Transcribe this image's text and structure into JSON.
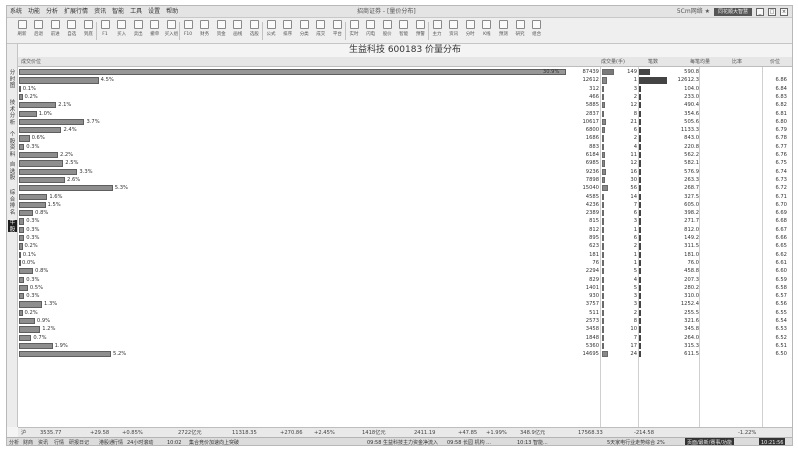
{
  "window": {
    "menu": [
      "系统",
      "功能",
      "分析",
      "扩展行情",
      "资讯",
      "智能",
      "工具",
      "设置",
      "帮助"
    ],
    "title": "招商证券 - [量价分布]",
    "right_text": "5Cm网络  ★",
    "login": "同花顺大智慧",
    "controls": [
      "_",
      "□",
      "×"
    ]
  },
  "toolbar": {
    "items": [
      "刷新",
      "后退",
      "前进",
      "自选",
      "到底",
      "F1",
      "买入",
      "卖出",
      "撤单",
      "买入组",
      "F10",
      "财务",
      "资金",
      "画线",
      "选股",
      "公式",
      "排序",
      "分类",
      "成交",
      "平台",
      "实时",
      "闪电",
      "股价",
      "智能",
      "预警",
      "主力",
      "资讯",
      "分时",
      "K线",
      "预测",
      "研究",
      "组合"
    ]
  },
  "sidebar": {
    "tabs": [
      "分时图",
      "技术分析",
      "个股资料",
      "自选股",
      "综合排名",
      "牛股"
    ]
  },
  "content": {
    "title": "生益科技 600183 价量分布",
    "columns": {
      "price": "成交价位",
      "volume": "成交量(手)",
      "count": "笔数",
      "avg": "每笔均量",
      "col5": "比率",
      "ratio": "价位"
    },
    "rows": [
      {
        "pct": "30.9%",
        "vol": "87439",
        "cnt": "149",
        "avg": "590.8",
        "ratio": "",
        "bar_pct": 30.9,
        "cnt_frac": 0.38,
        "hi": true
      },
      {
        "pct": "4.5%",
        "vol": "12612",
        "cnt": "1",
        "avg": "12612.3",
        "ratio": "6.86",
        "bar_pct": 4.5,
        "cnt_frac": 1.0
      },
      {
        "pct": "0.1%",
        "vol": "312",
        "cnt": "3",
        "avg": "104.0",
        "ratio": "6.84",
        "bar_pct": 0.1
      },
      {
        "pct": "0.2%",
        "vol": "466",
        "cnt": "2",
        "avg": "233.0",
        "ratio": "6.83",
        "bar_pct": 0.2
      },
      {
        "pct": "2.1%",
        "vol": "5885",
        "cnt": "12",
        "avg": "490.4",
        "ratio": "6.82",
        "bar_pct": 2.1
      },
      {
        "pct": "1.0%",
        "vol": "2837",
        "cnt": "8",
        "avg": "354.6",
        "ratio": "6.81",
        "bar_pct": 1.0
      },
      {
        "pct": "3.7%",
        "vol": "10617",
        "cnt": "21",
        "avg": "505.6",
        "ratio": "6.80",
        "bar_pct": 3.7
      },
      {
        "pct": "2.4%",
        "vol": "6800",
        "cnt": "6",
        "avg": "1133.3",
        "ratio": "6.79",
        "bar_pct": 2.4
      },
      {
        "pct": "0.6%",
        "vol": "1686",
        "cnt": "2",
        "avg": "843.0",
        "ratio": "6.78",
        "bar_pct": 0.6
      },
      {
        "pct": "0.3%",
        "vol": "883",
        "cnt": "4",
        "avg": "220.8",
        "ratio": "6.77",
        "bar_pct": 0.3
      },
      {
        "pct": "2.2%",
        "vol": "6184",
        "cnt": "11",
        "avg": "562.2",
        "ratio": "6.76",
        "bar_pct": 2.2
      },
      {
        "pct": "2.5%",
        "vol": "6985",
        "cnt": "12",
        "avg": "582.1",
        "ratio": "6.75",
        "bar_pct": 2.5
      },
      {
        "pct": "3.3%",
        "vol": "9236",
        "cnt": "16",
        "avg": "576.9",
        "ratio": "6.74",
        "bar_pct": 3.3
      },
      {
        "pct": "2.6%",
        "vol": "7898",
        "cnt": "30",
        "avg": "263.3",
        "ratio": "6.73",
        "bar_pct": 2.6
      },
      {
        "pct": "5.3%",
        "vol": "15040",
        "cnt": "56",
        "avg": "268.7",
        "ratio": "6.72",
        "bar_pct": 5.3
      },
      {
        "pct": "1.6%",
        "vol": "4585",
        "cnt": "14",
        "avg": "327.5",
        "ratio": "6.71",
        "bar_pct": 1.6
      },
      {
        "pct": "1.5%",
        "vol": "4236",
        "cnt": "7",
        "avg": "605.0",
        "ratio": "6.70",
        "bar_pct": 1.5
      },
      {
        "pct": "0.8%",
        "vol": "2389",
        "cnt": "6",
        "avg": "398.2",
        "ratio": "6.69",
        "bar_pct": 0.8
      },
      {
        "pct": "0.3%",
        "vol": "815",
        "cnt": "3",
        "avg": "271.7",
        "ratio": "6.68",
        "bar_pct": 0.3
      },
      {
        "pct": "0.3%",
        "vol": "812",
        "cnt": "1",
        "avg": "812.0",
        "ratio": "6.67",
        "bar_pct": 0.3
      },
      {
        "pct": "0.3%",
        "vol": "895",
        "cnt": "6",
        "avg": "149.2",
        "ratio": "6.66",
        "bar_pct": 0.3
      },
      {
        "pct": "0.2%",
        "vol": "623",
        "cnt": "2",
        "avg": "311.5",
        "ratio": "6.65",
        "bar_pct": 0.2
      },
      {
        "pct": "0.1%",
        "vol": "181",
        "cnt": "1",
        "avg": "181.0",
        "ratio": "6.62",
        "bar_pct": 0.1
      },
      {
        "pct": "0.0%",
        "vol": "76",
        "cnt": "1",
        "avg": "76.0",
        "ratio": "6.61",
        "bar_pct": 0.0
      },
      {
        "pct": "0.8%",
        "vol": "2294",
        "cnt": "5",
        "avg": "458.8",
        "ratio": "6.60",
        "bar_pct": 0.8
      },
      {
        "pct": "0.3%",
        "vol": "829",
        "cnt": "4",
        "avg": "207.3",
        "ratio": "6.59",
        "bar_pct": 0.3
      },
      {
        "pct": "0.5%",
        "vol": "1401",
        "cnt": "5",
        "avg": "280.2",
        "ratio": "6.58",
        "bar_pct": 0.5
      },
      {
        "pct": "0.3%",
        "vol": "930",
        "cnt": "3",
        "avg": "310.0",
        "ratio": "6.57",
        "bar_pct": 0.3
      },
      {
        "pct": "1.3%",
        "vol": "3757",
        "cnt": "3",
        "avg": "1252.4",
        "ratio": "6.56",
        "bar_pct": 1.3
      },
      {
        "pct": "0.2%",
        "vol": "511",
        "cnt": "2",
        "avg": "255.5",
        "ratio": "6.55",
        "bar_pct": 0.2
      },
      {
        "pct": "0.9%",
        "vol": "2573",
        "cnt": "8",
        "avg": "321.6",
        "ratio": "6.54",
        "bar_pct": 0.9
      },
      {
        "pct": "1.2%",
        "vol": "3458",
        "cnt": "10",
        "avg": "345.8",
        "ratio": "6.53",
        "bar_pct": 1.2
      },
      {
        "pct": "0.7%",
        "vol": "1848",
        "cnt": "7",
        "avg": "264.0",
        "ratio": "6.52",
        "bar_pct": 0.7
      },
      {
        "pct": "1.9%",
        "vol": "5360",
        "cnt": "17",
        "avg": "315.3",
        "ratio": "6.51",
        "bar_pct": 1.9
      },
      {
        "pct": "5.2%",
        "vol": "14695",
        "cnt": "24",
        "avg": "611.5",
        "ratio": "6.50",
        "bar_pct": 5.2
      }
    ]
  },
  "index_bar": [
    {
      "text": "沪"
    },
    {
      "text": "3535.77"
    },
    {
      "text": "+29.58"
    },
    {
      "text": "+0.85%"
    },
    {
      "text": "2722亿元"
    },
    {
      "text": "11318.35"
    },
    {
      "text": "+270.86"
    },
    {
      "text": "+2.45%"
    },
    {
      "text": "1418亿元"
    },
    {
      "text": "2411.19"
    },
    {
      "text": "+47.85"
    },
    {
      "text": "+1.99%"
    },
    {
      "text": "348.9亿元"
    },
    {
      "text": "17568.33"
    },
    {
      "text": "-214.58"
    },
    {
      "text": "-1.22%"
    }
  ],
  "status_bar": [
    {
      "text": "分析"
    },
    {
      "text": "财商"
    },
    {
      "text": "资讯"
    },
    {
      "text": "行情"
    },
    {
      "text": "研报日记"
    },
    {
      "text": "港股通"
    },
    {
      "text": "行情"
    },
    {
      "text": "24小时滚动"
    },
    {
      "text": "10:02"
    },
    {
      "text": "集合竞价加速向上突破"
    },
    {
      "text": "09:58 生益科技主力资金净流入"
    },
    {
      "text": "09:58 长园 机构 ..."
    },
    {
      "text": "10:13 智能..."
    },
    {
      "text": "5天家电行业走势综合 2%"
    },
    {
      "text": "页面/最新/赛事/功能"
    },
    {
      "text": "10:21:56"
    }
  ]
}
